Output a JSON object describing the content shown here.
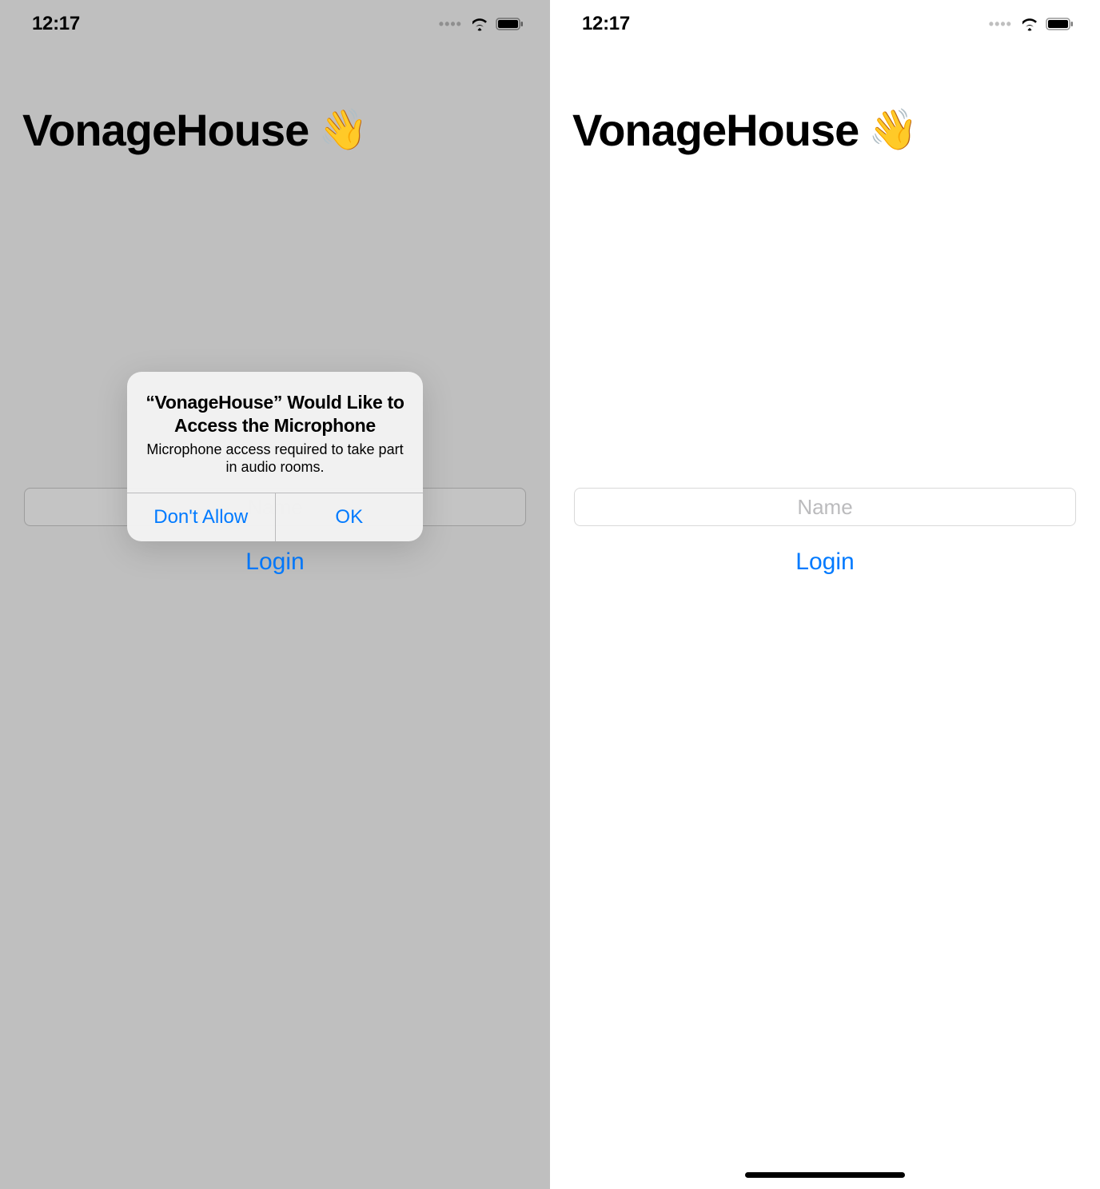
{
  "status": {
    "time": "12:17"
  },
  "app": {
    "title": "VonageHouse",
    "emoji": "👋"
  },
  "form": {
    "name_placeholder": "Name",
    "login": "Login"
  },
  "alert": {
    "title": "“VonageHouse” Would Like to Access the Microphone",
    "message": "Microphone access required to take part in audio rooms.",
    "deny": "Don't Allow",
    "allow": "OK"
  }
}
